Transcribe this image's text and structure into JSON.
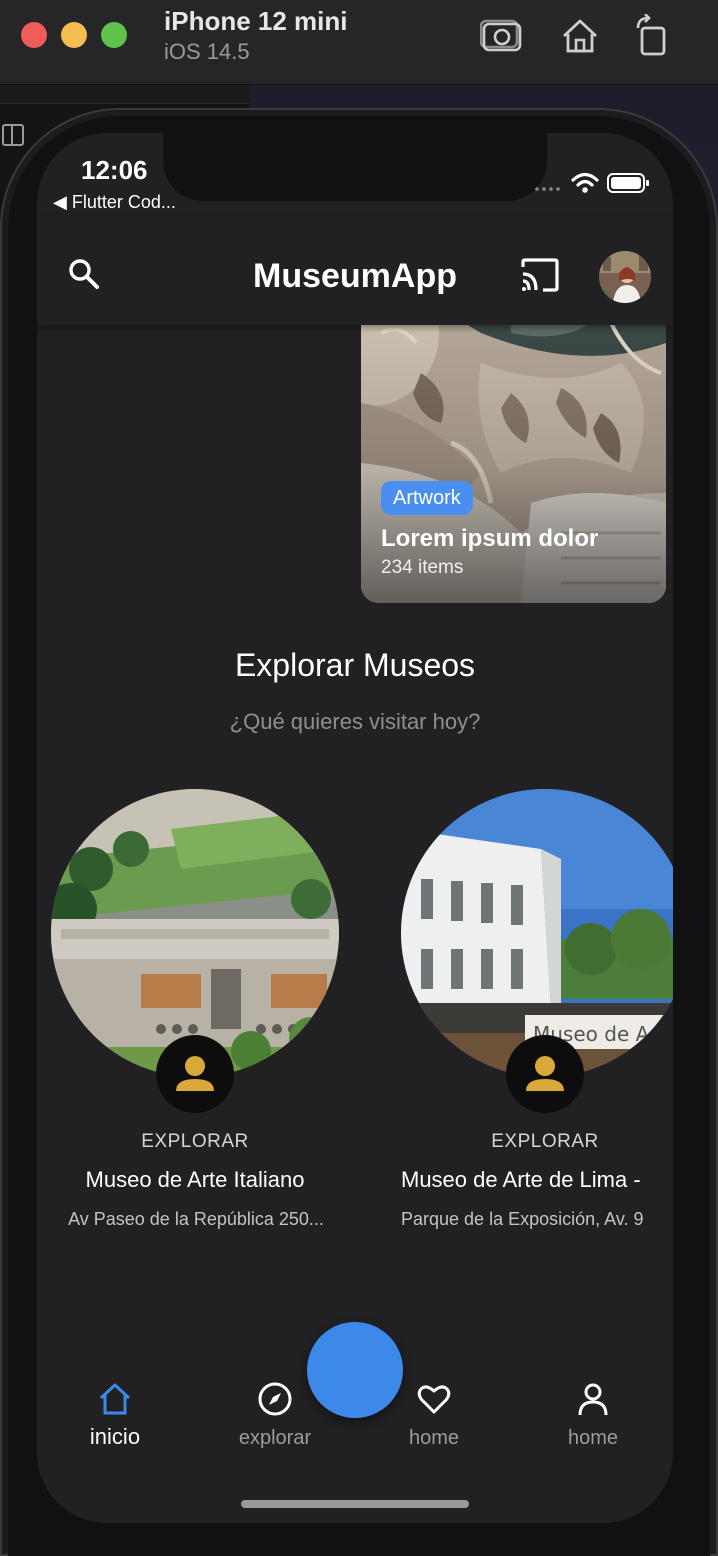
{
  "simulator": {
    "device": "iPhone 12 mini",
    "os": "iOS 14.5",
    "icons": [
      "screenshot-icon",
      "home-icon",
      "rotate-icon"
    ]
  },
  "status_bar": {
    "time": "12:06",
    "back_label": "◀ Flutter Cod..."
  },
  "app_bar": {
    "title": "MuseumApp",
    "icons": [
      "search-icon",
      "cast-icon",
      "avatar"
    ]
  },
  "category_card": {
    "badge": "Artwork",
    "title": "Lorem ipsum dolor",
    "count": "234 items",
    "badge_color": "#4a8ef0"
  },
  "section": {
    "title": "Explorar Museos",
    "subtitle": "¿Qué quieres visitar hoy?"
  },
  "museums": [
    {
      "explore_label": "EXPLORAR",
      "name": "Museo de Arte Italiano",
      "address": "Av Paseo de la República 250..."
    },
    {
      "explore_label": "EXPLORAR",
      "name": "Museo de Arte de Lima -",
      "address": "Parque de la Exposición, Av. 9"
    }
  ],
  "museum_badge_color": "#d9a93a",
  "bottom_nav": {
    "items": [
      {
        "label": "inicio",
        "icon": "home-icon"
      },
      {
        "label": "explorar",
        "icon": "compass-icon"
      },
      {
        "label": "home",
        "icon": "heart-icon"
      },
      {
        "label": "home",
        "icon": "person-icon"
      }
    ],
    "active_index": 0,
    "accent": "#3d89ea"
  }
}
